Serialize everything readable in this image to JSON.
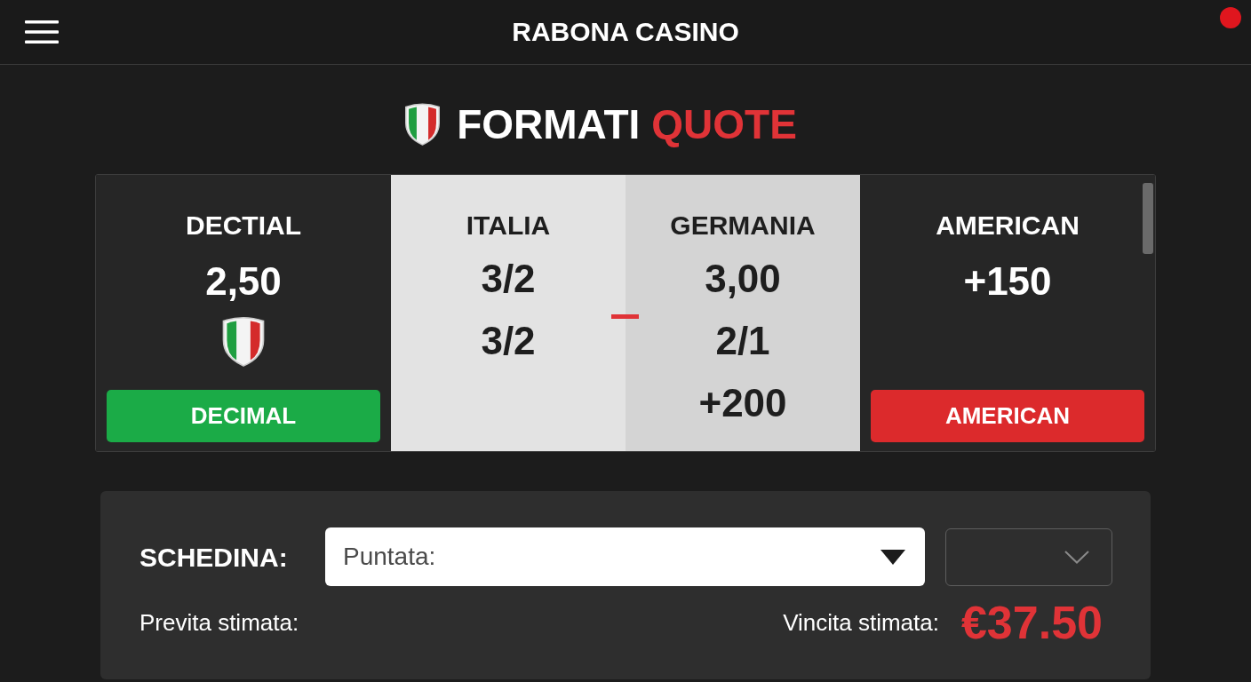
{
  "header": {
    "title": "RABONA CASINO",
    "indicator_dot": true
  },
  "heading": {
    "parts": [
      {
        "text": "FORMATI",
        "accent": false
      },
      {
        "text": "QUOTE",
        "accent": true
      }
    ]
  },
  "odds_panel": {
    "columns": [
      {
        "kind": "format",
        "label": "DECTIAL",
        "values": [
          "2,50"
        ],
        "flag": true,
        "button": {
          "label": "DECIMAL",
          "color": "#1bab47"
        }
      },
      {
        "kind": "team",
        "label": "ITALIA",
        "values": [
          "3/2",
          "3/2"
        ]
      },
      {
        "kind": "team",
        "label": "GERMANIA",
        "values": [
          "3,00",
          "2/1",
          "+200"
        ]
      },
      {
        "kind": "format",
        "label": "AMERICAN",
        "values": [
          "+150"
        ],
        "flag": false,
        "button": {
          "label": "AMERICAN",
          "color": "#dc2a2c"
        }
      }
    ]
  },
  "betslip": {
    "label": "SCHEDINA:",
    "stake_select": {
      "placeholder": "Puntata:"
    },
    "estimate_label": "Previta stimata:",
    "win_label": "Vincita stimata:",
    "win_amount": "€37.50"
  }
}
